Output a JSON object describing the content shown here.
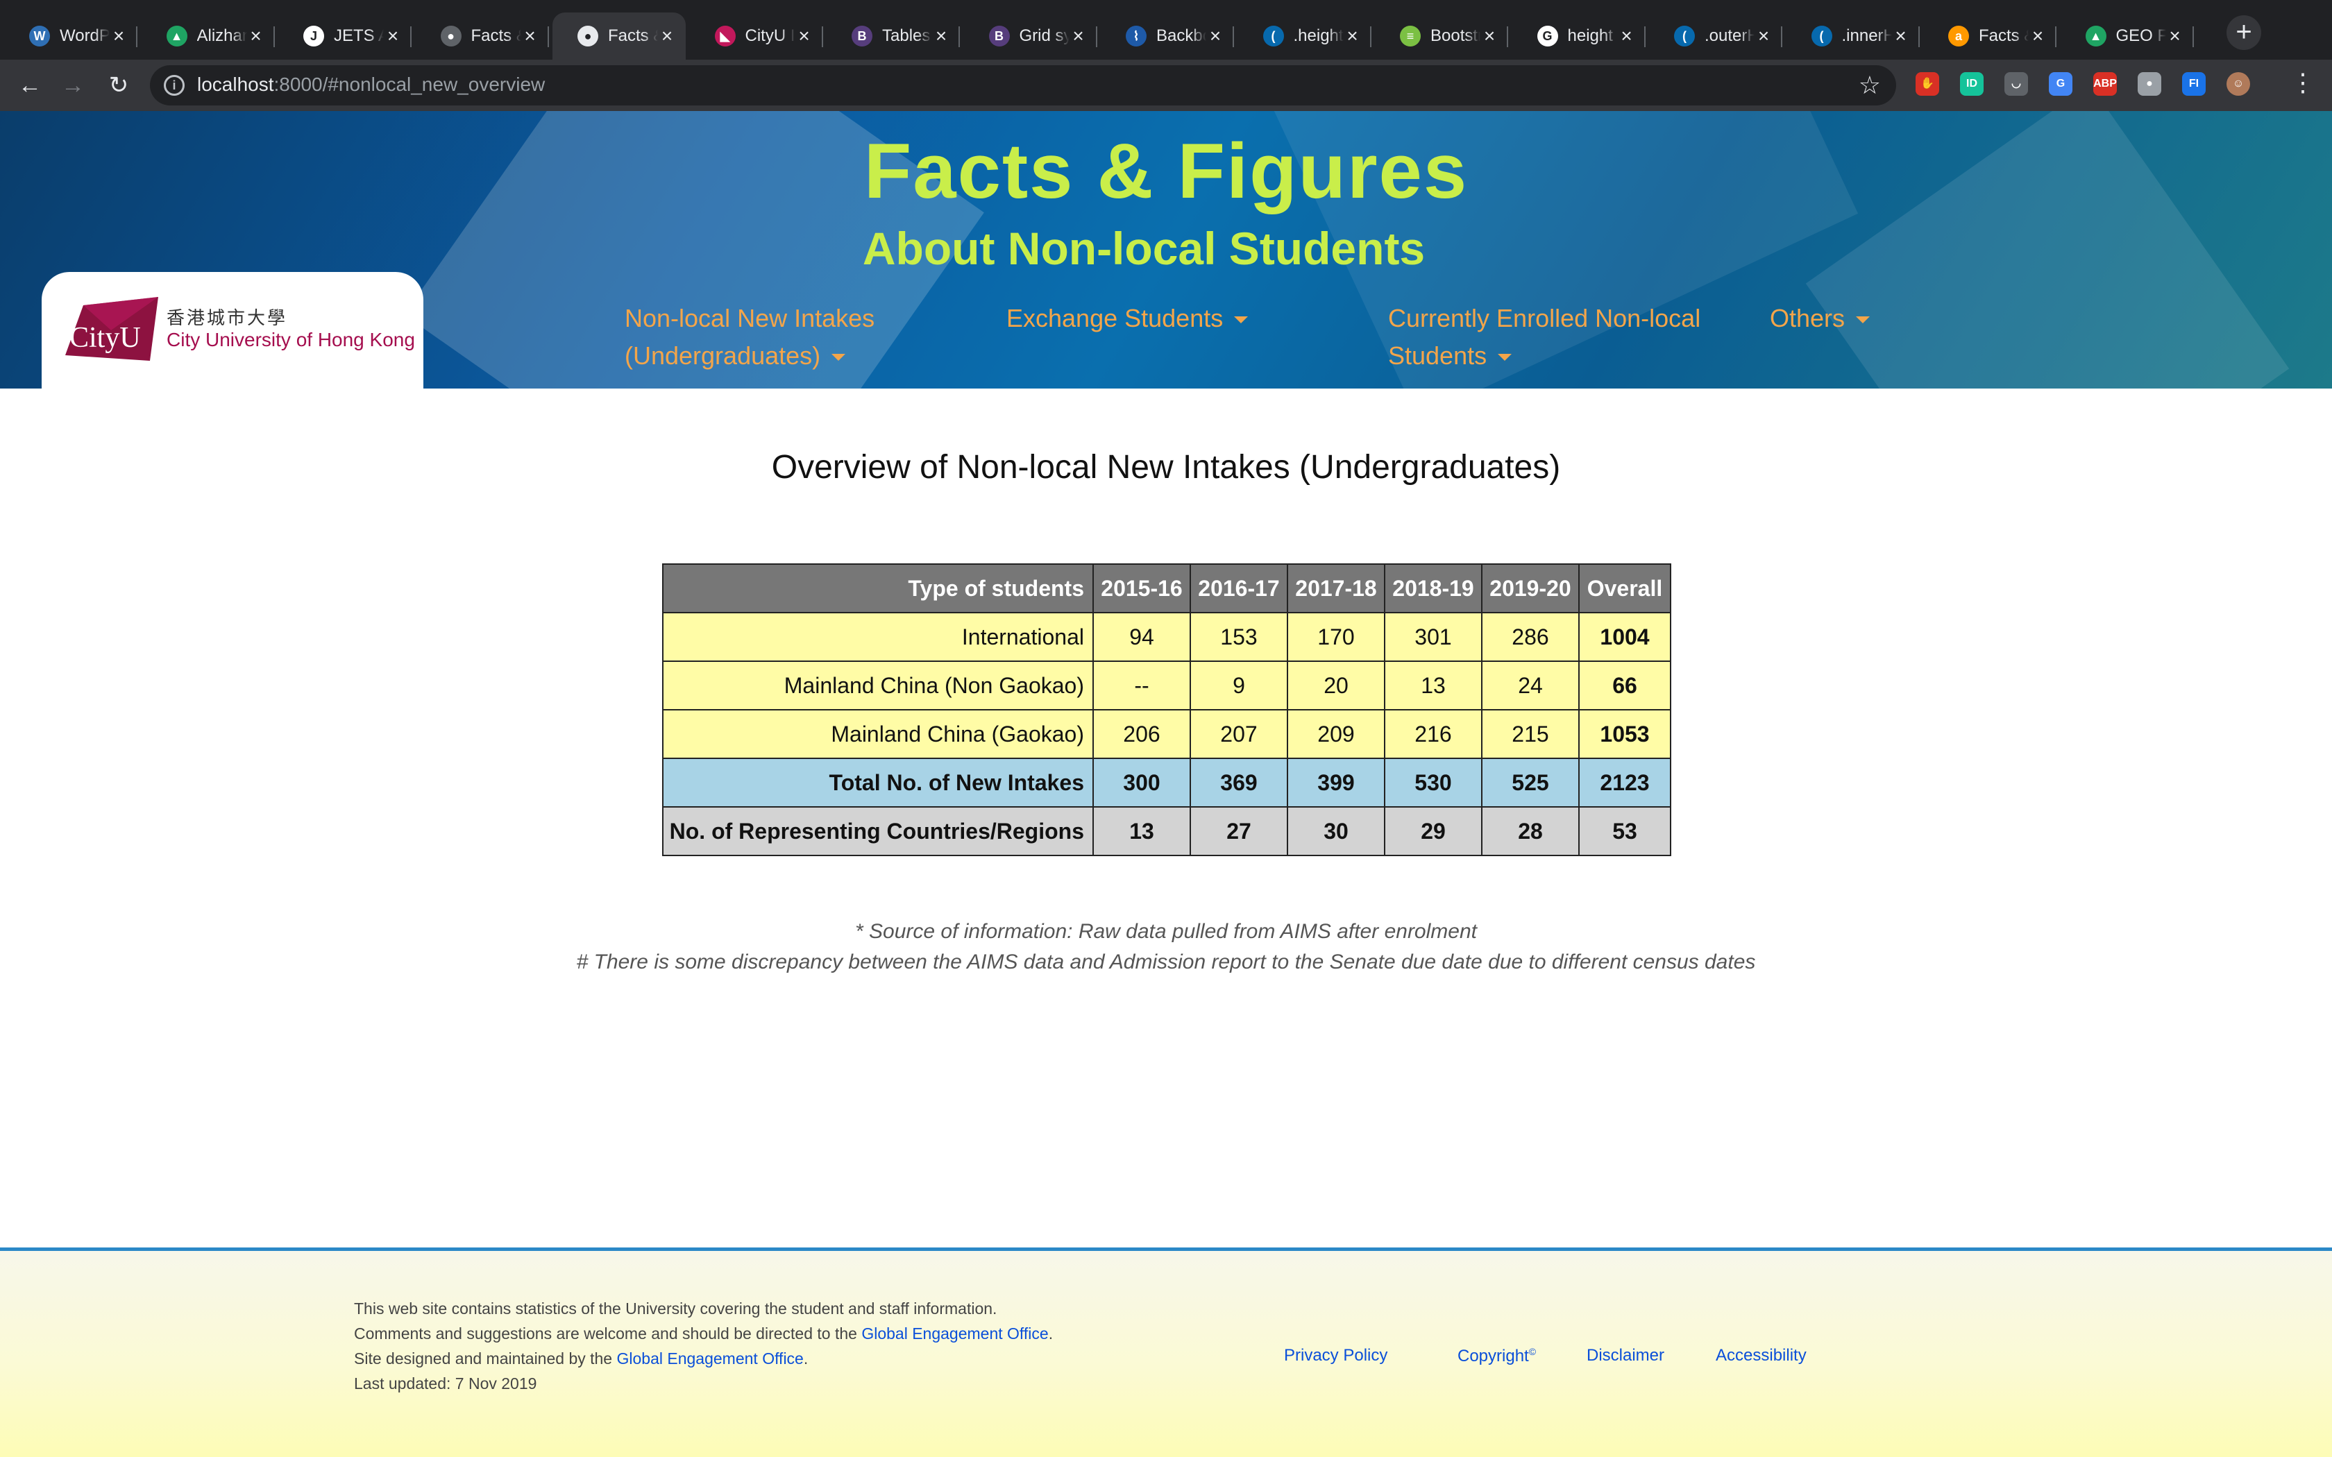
{
  "browser": {
    "tabs": [
      {
        "label": "WordPress",
        "icon": "wordpress-icon",
        "color": "#2f6fb4",
        "glyph": "W"
      },
      {
        "label": "Alizhan",
        "icon": "google-drive-icon",
        "color": "#1fa463",
        "glyph": "▲"
      },
      {
        "label": "JETS A",
        "icon": "jets-icon",
        "color": "#ffffff",
        "glyph": "J"
      },
      {
        "label": "Facts &",
        "icon": "globe-icon",
        "color": "#5f6368",
        "glyph": "●"
      },
      {
        "label": "Facts &",
        "icon": "globe-icon",
        "color": "#e8eaed",
        "glyph": "●",
        "active": true
      },
      {
        "label": "CityU I",
        "icon": "cityu-icon",
        "color": "#c2185b",
        "glyph": "◣"
      },
      {
        "label": "Tables",
        "icon": "bootstrap-icon",
        "color": "#563d7c",
        "glyph": "B"
      },
      {
        "label": "Grid sy",
        "icon": "bootstrap-icon",
        "color": "#563d7c",
        "glyph": "B"
      },
      {
        "label": "Backbo",
        "icon": "backbone-icon",
        "color": "#1e5aa8",
        "glyph": "⌇"
      },
      {
        "label": ".height",
        "icon": "jquery-icon",
        "color": "#0769ad",
        "glyph": "("
      },
      {
        "label": "Bootstr",
        "icon": "bootstrap-build-icon",
        "color": "#7bc043",
        "glyph": "≡"
      },
      {
        "label": "height",
        "icon": "google-icon",
        "color": "#ffffff",
        "glyph": "G"
      },
      {
        "label": ".outerH",
        "icon": "jquery-icon",
        "color": "#0769ad",
        "glyph": "("
      },
      {
        "label": ".innerH",
        "icon": "jquery-icon",
        "color": "#0769ad",
        "glyph": "("
      },
      {
        "label": "Facts &",
        "icon": "amazon-icon",
        "color": "#ff9900",
        "glyph": "a"
      },
      {
        "label": "GEO F",
        "icon": "google-drive-icon",
        "color": "#1fa463",
        "glyph": "▲"
      }
    ],
    "url_host": "localhost",
    "url_rest": ":8000/#nonlocal_new_overview",
    "extensions": [
      {
        "icon": "shield-extension-icon",
        "color": "#d93025",
        "glyph": "✋"
      },
      {
        "icon": "grammarly-extension-icon",
        "color": "#15c39a",
        "glyph": "ID"
      },
      {
        "icon": "pocket-extension-icon",
        "color": "#5f6368",
        "glyph": "◡"
      },
      {
        "icon": "translate-extension-icon",
        "color": "#4285f4",
        "glyph": "G"
      },
      {
        "icon": "adblock-extension-icon",
        "color": "#d93025",
        "glyph": "ABP"
      },
      {
        "icon": "circle-extension-icon",
        "color": "#9aa0a6",
        "glyph": "●"
      },
      {
        "icon": "fi-extension-icon",
        "color": "#1a73e8",
        "glyph": "FI"
      },
      {
        "icon": "profile-avatar-icon",
        "color": "#b07a5a",
        "glyph": "☺"
      }
    ]
  },
  "site": {
    "title": "Facts & Figures",
    "subtitle": "About Non-local Students",
    "logo_word": "CityU",
    "logo_cn": "香港城市大學",
    "logo_en": "City University of Hong Kong",
    "nav": [
      {
        "line1": "Non-local New Intakes",
        "line2": "(Undergraduates)"
      },
      {
        "line1": "Exchange Students",
        "line2": ""
      },
      {
        "line1": "Currently Enrolled Non-local",
        "line2": "Students"
      },
      {
        "line1": "Others",
        "line2": ""
      }
    ]
  },
  "main": {
    "heading": "Overview of Non-local New Intakes (Undergraduates)",
    "table": {
      "headers": [
        "Type of students",
        "2015-16",
        "2016-17",
        "2017-18",
        "2018-19",
        "2019-20",
        "Overall"
      ],
      "rows": [
        {
          "label": "International",
          "values": [
            "94",
            "153",
            "170",
            "301",
            "286"
          ],
          "overall": "1004",
          "style": "norm"
        },
        {
          "label": "Mainland China (Non Gaokao)",
          "values": [
            "--",
            "9",
            "20",
            "13",
            "24"
          ],
          "overall": "66",
          "style": "norm"
        },
        {
          "label": "Mainland China (Gaokao)",
          "values": [
            "206",
            "207",
            "209",
            "216",
            "215"
          ],
          "overall": "1053",
          "style": "norm"
        },
        {
          "label": "Total No. of New Intakes",
          "values": [
            "300",
            "369",
            "399",
            "530",
            "525"
          ],
          "overall": "2123",
          "style": "total"
        },
        {
          "label": "No. of Representing Countries/Regions",
          "values": [
            "13",
            "27",
            "30",
            "29",
            "28"
          ],
          "overall": "53",
          "style": "countries"
        }
      ]
    },
    "note1": "* Source of information: Raw data pulled from AIMS after enrolment",
    "note2": "# There is some discrepancy between the AIMS data and Admission report to the Senate due date due to different census dates"
  },
  "footer": {
    "line1": "This web site contains statistics of the University covering the student and staff information.",
    "line2_pre": "Comments and suggestions are welcome and should be directed to the ",
    "line2_link": "Global Engagement Office",
    "line2_post": ".",
    "line3_pre": "Site designed and maintained by the ",
    "line3_link": "Global Engagement Office",
    "line3_post": ".",
    "line4": "Last updated: 7 Nov 2019",
    "links": {
      "privacy": "Privacy Policy",
      "copyright": "Copyright",
      "copyright_sup": "©",
      "disclaimer": "Disclaimer",
      "accessibility": "Accessibility"
    }
  }
}
